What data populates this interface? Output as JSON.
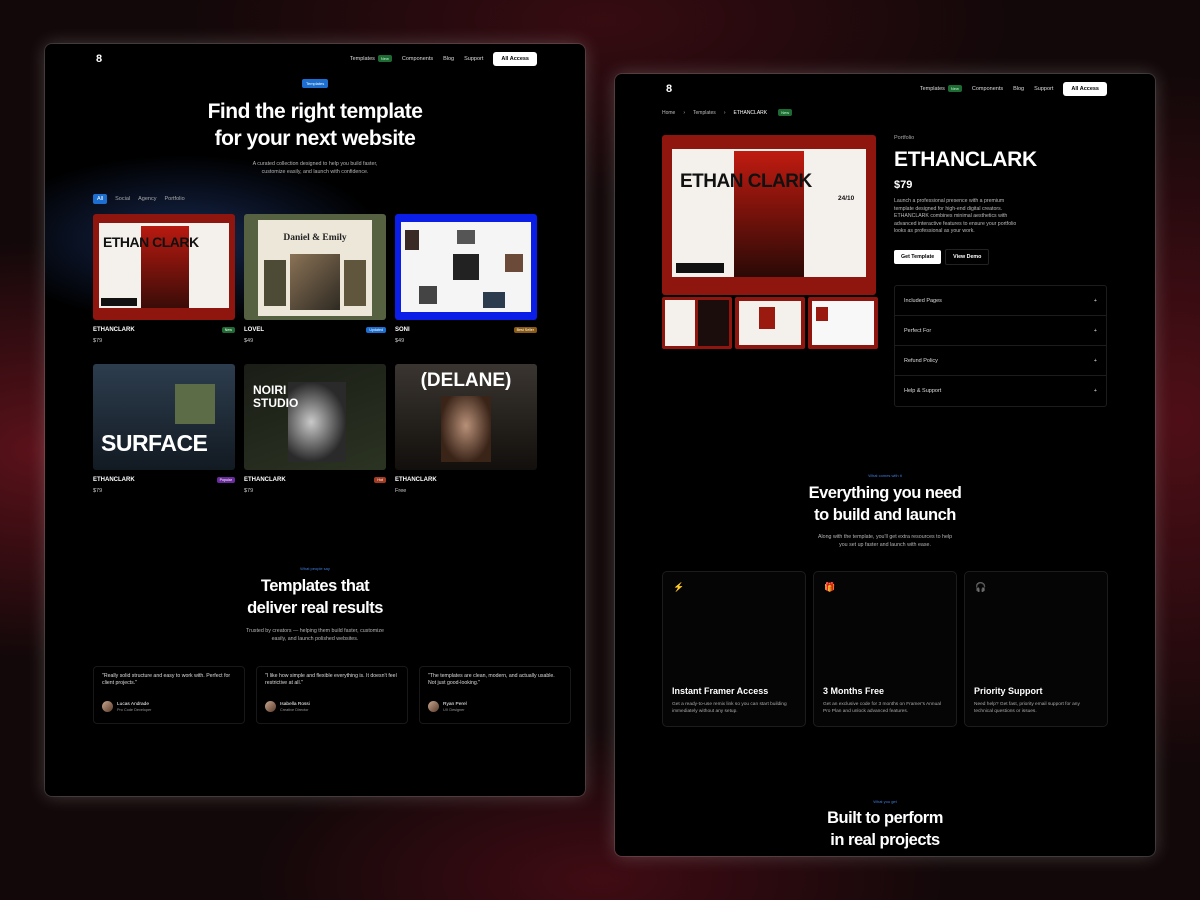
{
  "nav": {
    "logo": "8",
    "templates": "Templates",
    "new_badge": "New",
    "components": "Components",
    "blog": "Blog",
    "support": "Support",
    "cta": "All Access"
  },
  "listing": {
    "badge": "Templates",
    "title_line1": "Find the right template",
    "title_line2": "for your next website",
    "subtitle_line1": "A curated collection designed to help you build faster,",
    "subtitle_line2": "customize easily, and launch with confidence.",
    "filters": [
      "All",
      "Social",
      "Agency",
      "Portfolio"
    ],
    "cards": [
      {
        "name": "ETHANCLARK",
        "price": "$79",
        "tag": "New",
        "tag_color": "#1d6b33",
        "art": "ETHAN CLARK"
      },
      {
        "name": "LOVEL",
        "price": "$49",
        "tag": "Updated",
        "tag_color": "#1c6fd0",
        "art": "Daniel & Emily"
      },
      {
        "name": "SONI",
        "price": "$49",
        "tag": "Best Seller",
        "tag_color": "#8a5a14",
        "art": ""
      },
      {
        "name": "ETHANCLARK",
        "price": "$79",
        "tag": "Popular",
        "tag_color": "#6b2a9e",
        "art": "SURFACE"
      },
      {
        "name": "ETHANCLARK",
        "price": "$79",
        "tag": "Hot",
        "tag_color": "#a33a22",
        "art": "NOIRI STUDIO"
      },
      {
        "name": "ETHANCLARK",
        "price": "Free",
        "tag": "",
        "tag_color": "",
        "art": "(DELANE)"
      }
    ],
    "results": {
      "eyebrow": "What people say",
      "title_line1": "Templates that",
      "title_line2": "deliver real results",
      "sub_line1": "Trusted by creators — helping them build faster, customize",
      "sub_line2": "easily, and launch polished websites."
    },
    "testimonials": [
      {
        "quote": "\"Really solid structure and easy to work with. Perfect for client projects.\"",
        "name": "Lucas Andrade",
        "role": "Pro Code Developer"
      },
      {
        "quote": "\"I like how simple and flexible everything is. It doesn't feel restrictive at all.\"",
        "name": "Isabella Rossi",
        "role": "Creative Director"
      },
      {
        "quote": "\"The templates are clean, modern, and actually usable. Not just good-looking.\"",
        "name": "Ryan Perel",
        "role": "UX Designer"
      }
    ]
  },
  "detail": {
    "breadcrumb": [
      "Home",
      "Templates",
      "ETHANCLARK"
    ],
    "breadcrumb_badge": "New",
    "hero_art": "ETHAN CLARK",
    "hero_date": "24/10",
    "category": "Portfolio",
    "title": "ETHANCLARK",
    "price": "$79",
    "description": "Launch a professional presence with a premium template designed for high-end digital creators. ETHANCLARK combines minimal aesthetics with advanced interactive features to ensure your portfolio looks as professional as your work.",
    "get_template": "Get Template",
    "view_demo": "View Demo",
    "accordion": [
      "Included Pages",
      "Perfect For",
      "Refund Policy",
      "Help & Support"
    ],
    "everything": {
      "eyebrow": "What comes with it",
      "title_line1": "Everything you need",
      "title_line2": "to build and launch",
      "sub_line1": "Along with the template, you'll get extra resources to help",
      "sub_line2": "you set up faster and launch with ease."
    },
    "features": [
      {
        "icon": "⚡",
        "title": "Instant Framer Access",
        "desc": "Get a ready-to-use remix link so you can start building immediately without any setup."
      },
      {
        "icon": "🎁",
        "title": "3 Months Free",
        "desc": "Get an exclusive code for 3 months on Framer's Annual Pro Plan and unlock advanced features."
      },
      {
        "icon": "🎧",
        "title": "Priority Support",
        "desc": "Need help? Get fast, priority email support for any technical questions or issues."
      }
    ],
    "perform": {
      "eyebrow": "What you get",
      "title_line1": "Built to perform",
      "title_line2": "in real projects"
    }
  }
}
